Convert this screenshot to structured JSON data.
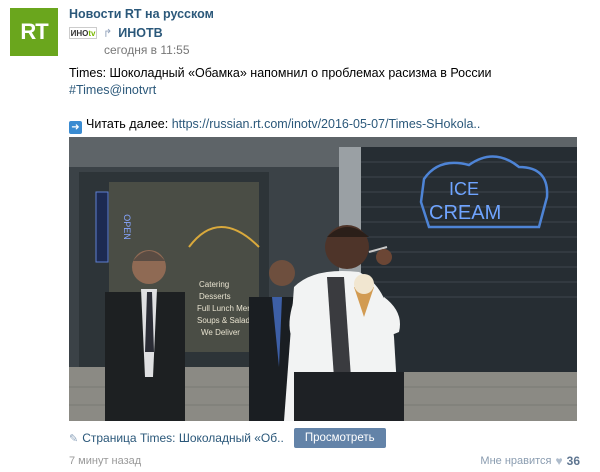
{
  "group": {
    "name": "Новости RT на русском",
    "avatar_text": "RT",
    "brand_color": "#6aa61d"
  },
  "repost": {
    "logo_text_main": "ИНО",
    "logo_text_accent": "tv",
    "name": "ИНОТВ",
    "date": "сегодня в 11:55"
  },
  "post": {
    "headline": "Times: Шоколадный «Обамка» напомнил о проблемах расизма в России",
    "hashtag": "#Times@inotvrt",
    "read_more_label": "Читать далее:",
    "read_more_url": "https://russian.rt.com/inotv/2016-05-07/Times-SHokola.."
  },
  "attachment": {
    "page_label": "Страница Times: Шоколадный «Об..",
    "view_button": "Просмотреть"
  },
  "photo": {
    "sign_ice": "ICE",
    "sign_cream": "CREAM",
    "sign_open": "OPEN",
    "menu_lines": [
      "Catering",
      "Desserts",
      "Full Lunch Menu",
      "Soups & Salads",
      "We Deliver"
    ]
  },
  "footer": {
    "time_ago": "7 минут назад",
    "like_label": "Мне нравится",
    "like_count": "36"
  }
}
